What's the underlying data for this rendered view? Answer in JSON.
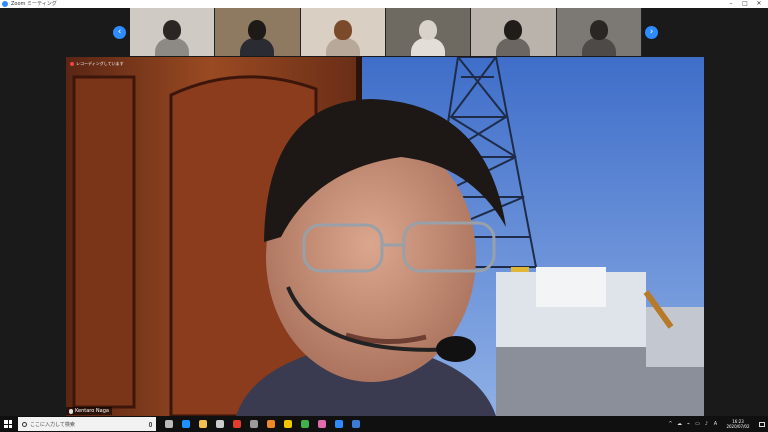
{
  "window": {
    "title": "Zoom ミーティング",
    "controls": [
      "–",
      "□",
      "✕"
    ]
  },
  "gallery": {
    "prev_label": "‹",
    "next_label": "›",
    "participants": [
      {
        "bg": "#cfcac3",
        "hair": "#2b2523",
        "shirt": "#8d8a86"
      },
      {
        "bg": "#8d7a60",
        "hair": "#1e1a17",
        "shirt": "#2b2b33"
      },
      {
        "bg": "#d9cfc2",
        "hair": "#7a4a2a",
        "shirt": "#b7a89a"
      },
      {
        "bg": "#6e6a62",
        "hair": "#d8d2ca",
        "shirt": "#e3ded7"
      },
      {
        "bg": "#b9b3ac",
        "hair": "#1f1c1a",
        "shirt": "#6b6661"
      },
      {
        "bg": "#7c7874",
        "hair": "#2a2624",
        "shirt": "#4d4a47"
      }
    ]
  },
  "recording": {
    "text": "レコーディングしています"
  },
  "speaker": {
    "name": "Kentaro Naga"
  },
  "taskbar": {
    "search_placeholder": "ここに入力して検索",
    "apps": [
      "task-view",
      "edge",
      "file-explorer",
      "store",
      "app-red",
      "app-gray",
      "app-orange",
      "app-yellow",
      "chrome",
      "app-pink",
      "zoom",
      "app-blue"
    ],
    "app_colors": [
      "#bbbbbb",
      "#1e90ff",
      "#f2c14e",
      "#cccccc",
      "#e33b2e",
      "#9a9a9a",
      "#f08a24",
      "#f3c400",
      "#3fb04a",
      "#e46ab0",
      "#2d8cff",
      "#3a7bd5"
    ],
    "tray_glyphs": [
      "^",
      "☁",
      "⌁",
      "▭",
      "♪",
      "A"
    ],
    "time": "16:23",
    "date": "2020/07/02"
  }
}
